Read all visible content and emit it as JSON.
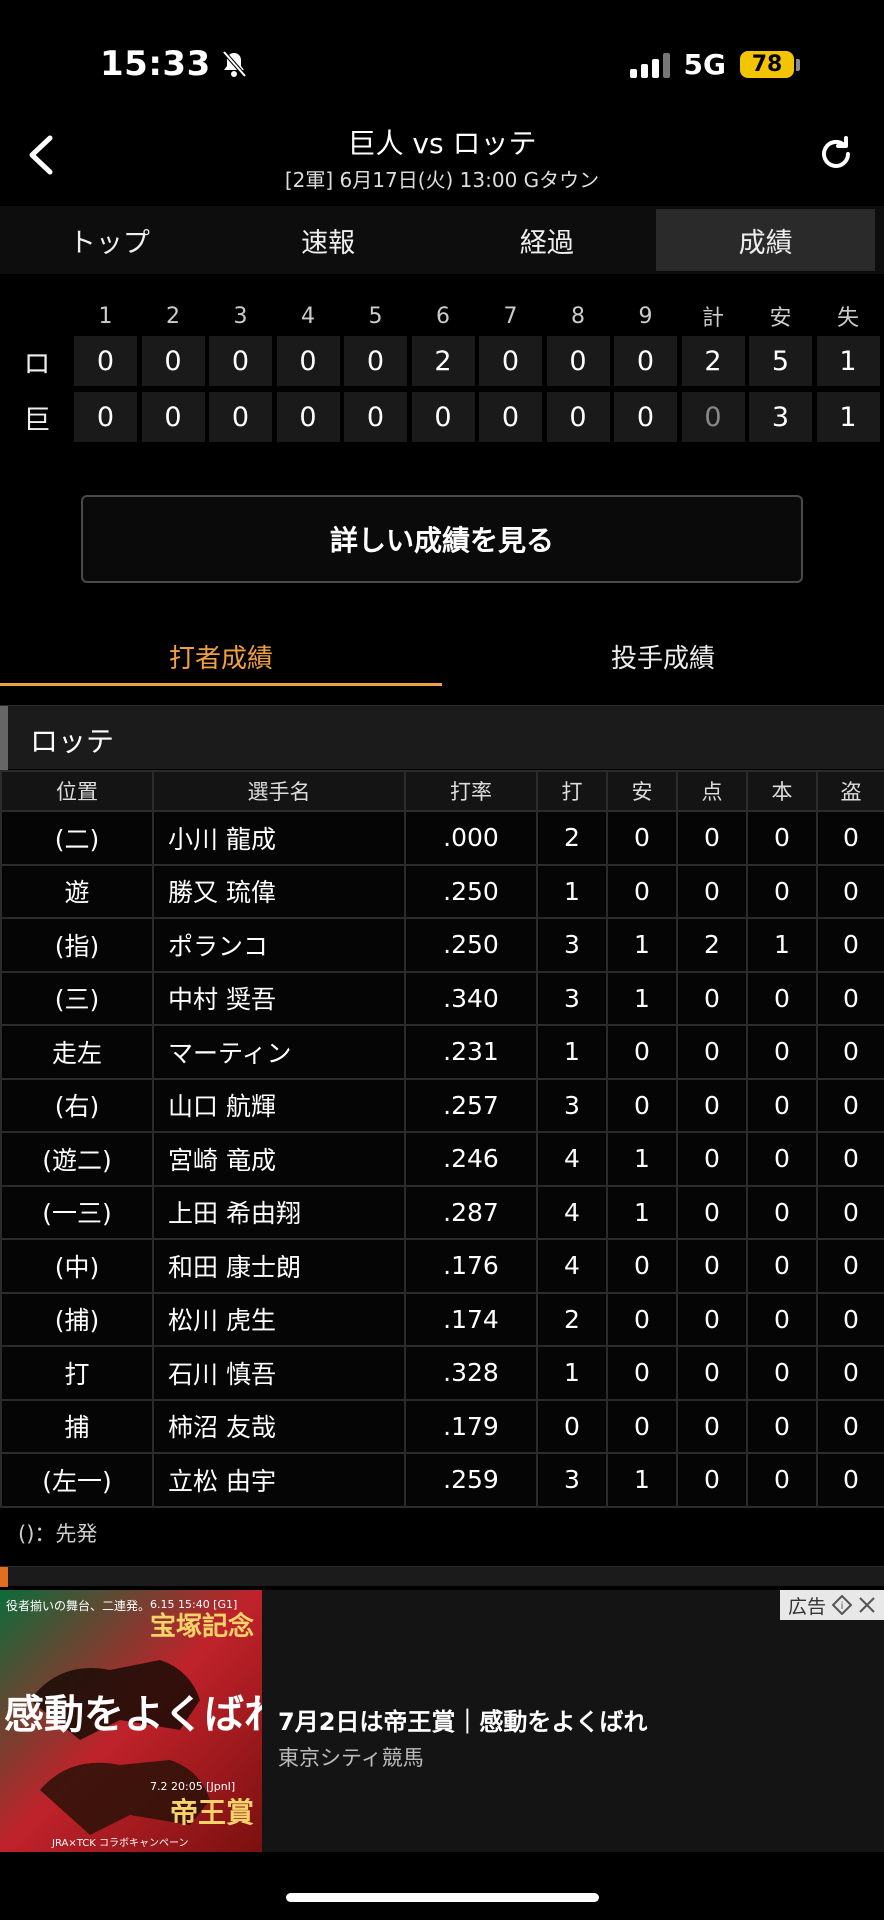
{
  "status_bar": {
    "time": "15:33",
    "network": "5G",
    "battery": "78"
  },
  "header": {
    "title": "巨人 vs ロッテ",
    "subtitle": "[2軍] 6月17日(火) 13:00 Gタウン"
  },
  "tabs": [
    {
      "label": "トップ"
    },
    {
      "label": "速報"
    },
    {
      "label": "経過"
    },
    {
      "label": "成績"
    }
  ],
  "scoreboard": {
    "headers": [
      "1",
      "2",
      "3",
      "4",
      "5",
      "6",
      "7",
      "8",
      "9",
      "計",
      "安",
      "失"
    ],
    "rows": [
      {
        "team": "ロ",
        "cells": [
          "0",
          "0",
          "0",
          "0",
          "0",
          "2",
          "0",
          "0",
          "0",
          "2",
          "5",
          "1"
        ]
      },
      {
        "team": "巨",
        "cells": [
          "0",
          "0",
          "0",
          "0",
          "0",
          "0",
          "0",
          "0",
          "0",
          "0",
          "3",
          "1"
        ]
      }
    ]
  },
  "detail_button": "詳しい成績を見る",
  "sub_tabs": [
    {
      "label": "打者成績"
    },
    {
      "label": "投手成績"
    }
  ],
  "team_section": "ロッテ",
  "batting": {
    "headers": [
      "位置",
      "選手名",
      "打率",
      "打",
      "安",
      "点",
      "本",
      "盗"
    ],
    "rows": [
      {
        "pos": "(二)",
        "name": "小川 龍成",
        "avg": ".000",
        "ab": "2",
        "h": "0",
        "rbi": "0",
        "hr": "0",
        "sb": "0"
      },
      {
        "pos": "遊",
        "name": "勝又 琉偉",
        "avg": ".250",
        "ab": "1",
        "h": "0",
        "rbi": "0",
        "hr": "0",
        "sb": "0"
      },
      {
        "pos": "(指)",
        "name": "ポランコ",
        "avg": ".250",
        "ab": "3",
        "h": "1",
        "rbi": "2",
        "hr": "1",
        "sb": "0"
      },
      {
        "pos": "(三)",
        "name": "中村 奨吾",
        "avg": ".340",
        "ab": "3",
        "h": "1",
        "rbi": "0",
        "hr": "0",
        "sb": "0"
      },
      {
        "pos": "走左",
        "name": "マーティン",
        "avg": ".231",
        "ab": "1",
        "h": "0",
        "rbi": "0",
        "hr": "0",
        "sb": "0"
      },
      {
        "pos": "(右)",
        "name": "山口 航輝",
        "avg": ".257",
        "ab": "3",
        "h": "0",
        "rbi": "0",
        "hr": "0",
        "sb": "0"
      },
      {
        "pos": "(遊二)",
        "name": "宮崎 竜成",
        "avg": ".246",
        "ab": "4",
        "h": "1",
        "rbi": "0",
        "hr": "0",
        "sb": "0"
      },
      {
        "pos": "(一三)",
        "name": "上田 希由翔",
        "avg": ".287",
        "ab": "4",
        "h": "1",
        "rbi": "0",
        "hr": "0",
        "sb": "0"
      },
      {
        "pos": "(中)",
        "name": "和田 康士朗",
        "avg": ".176",
        "ab": "4",
        "h": "0",
        "rbi": "0",
        "hr": "0",
        "sb": "0"
      },
      {
        "pos": "(捕)",
        "name": "松川 虎生",
        "avg": ".174",
        "ab": "2",
        "h": "0",
        "rbi": "0",
        "hr": "0",
        "sb": "0"
      },
      {
        "pos": "打",
        "name": "石川 慎吾",
        "avg": ".328",
        "ab": "1",
        "h": "0",
        "rbi": "0",
        "hr": "0",
        "sb": "0"
      },
      {
        "pos": "捕",
        "name": "柿沼 友哉",
        "avg": ".179",
        "ab": "0",
        "h": "0",
        "rbi": "0",
        "hr": "0",
        "sb": "0"
      },
      {
        "pos": "(左一)",
        "name": "立松 由宇",
        "avg": ".259",
        "ab": "3",
        "h": "1",
        "rbi": "0",
        "hr": "0",
        "sb": "0"
      }
    ]
  },
  "footnote": "()：先発",
  "ad": {
    "title": "7月2日は帝王賞｜感動をよくばれ",
    "sponsor": "東京シティ競馬",
    "badge": "広告",
    "image": {
      "top_text": "役者揃いの舞台、二連発。",
      "date1": "6.15 15:40 [G1]",
      "race1": "宝塚記念",
      "slogan": "感動をよくばれ",
      "date2": "7.2 20:05 [JpnI]",
      "race2": "帝王賞",
      "footer": "JRA×TCK コラボキャンペーン"
    }
  }
}
